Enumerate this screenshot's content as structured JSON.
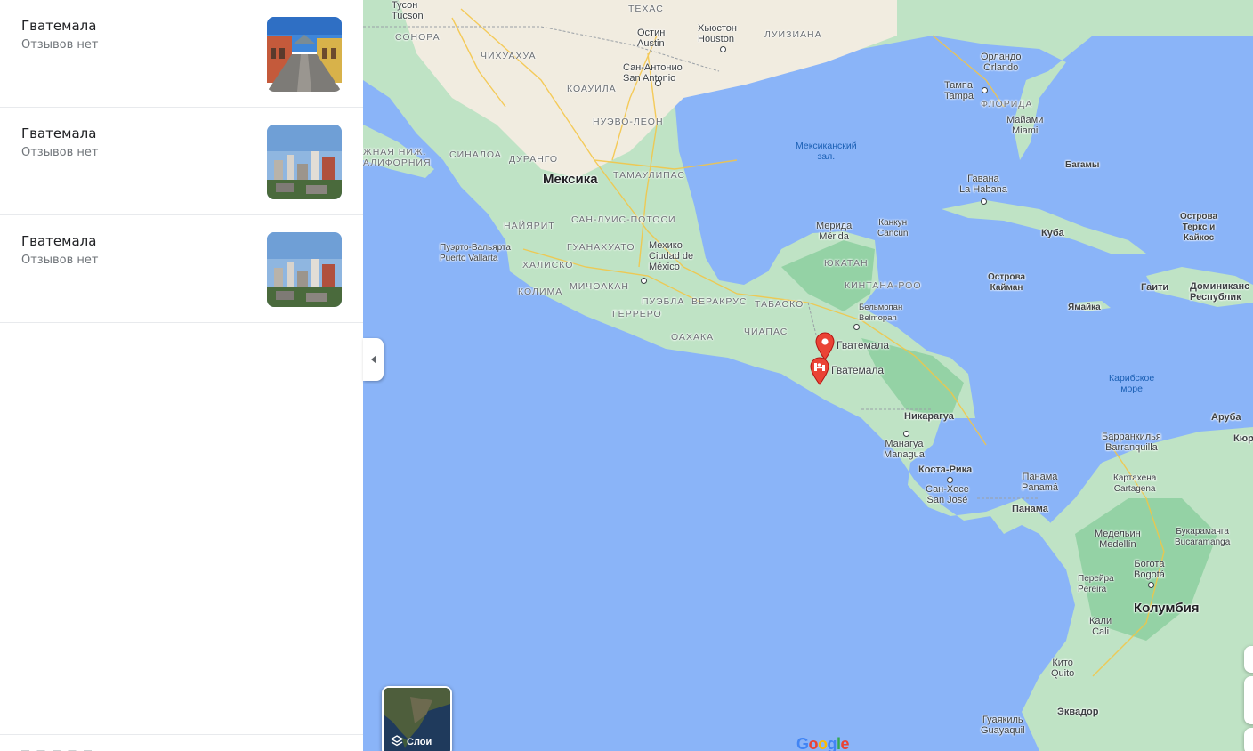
{
  "results": [
    {
      "title": "Гватемала",
      "reviews": "Отзывов нет",
      "photo": "street-photo"
    },
    {
      "title": "Гватемала",
      "reviews": "Отзывов нет",
      "photo": "city-photo"
    },
    {
      "title": "Гватемала",
      "reviews": "Отзывов нет",
      "photo": "city-photo"
    }
  ],
  "map": {
    "layers_label": "Слои",
    "logo": "Google",
    "colors": {
      "water": "#8ab4f8",
      "land": "#bfe3c5",
      "forest": "#94d2a5",
      "desert": "#f1ece0",
      "pin": "#ea4335"
    },
    "pins": [
      {
        "label": "Гватемала"
      },
      {
        "label": "Гватемала"
      }
    ],
    "labels": {
      "tucson": "Tucson",
      "tucson_ru": "Тусон",
      "texas": "ТЕХАС",
      "sonora": "СОНОРА",
      "austin_ru": "Остин",
      "austin": "Austin",
      "houston_ru": "Хьюстон",
      "houston": "Houston",
      "louisiana": "ЛУИЗИАНА",
      "chihuahua": "ЧИХУАХУА",
      "san_antonio_ru": "Сан-Антонио",
      "san_antonio": "San Antonio",
      "orlando_ru": "Орландо",
      "orlando": "Orlando",
      "tampa_ru": "Тампа",
      "tampa": "Tampa",
      "florida": "ФЛОРИДА",
      "miami_ru": "Майами",
      "miami": "Miami",
      "coahuila": "КОАУИЛА",
      "nuevo_leon": "НУЭВО-ЛЕОН",
      "gulf_1": "Мексиканский",
      "gulf_2": "зал.",
      "bahamas": "Багамы",
      "baja_1": "ЖНАЯ НИЖ.",
      "baja_2": "АЛИФОРНИЯ",
      "sinaloa": "СИНАЛОА",
      "durango": "ДУРАНГО",
      "mexico": "Мексика",
      "tamaulipas": "ТАМАУЛИПАС",
      "havana_ru": "Гавана",
      "havana": "La Habana",
      "slp": "САН-ЛУИС-ПОТОСИ",
      "nayarit": "НАЙЯРИТ",
      "merida_ru": "Мерида",
      "merida": "Mérida",
      "cancun_ru": "Канкун",
      "cancun": "Cancún",
      "cuba": "Куба",
      "turks_1": "Острова",
      "turks_2": "Теркс и",
      "turks_3": "Кайкос",
      "pv_ru": "Пуэрто-Вальярта",
      "pv": "Puerto Vallarta",
      "guanajuato": "ГУАНАХУАТО",
      "mexico_city_ru": "Мехико",
      "mexico_city_1": "Ciudad de",
      "mexico_city_2": "México",
      "yucatan": "ЮКАТАН",
      "jalisco": "ХАЛИСКО",
      "cayman_1": "Острова",
      "cayman_2": "Кайман",
      "haiti": "Гаити",
      "dominican_1": "Доминиканс",
      "dominican_2": "Республик",
      "colima": "КОЛИМА",
      "michoacan": "МИЧОАКАН",
      "puebla": "ПУЭБЛА",
      "veracruz": "ВЕРАКРУС",
      "qroo": "КИНТАНА-РОО",
      "tabasco": "ТАБАСКО",
      "belmopan_ru": "Бельмопан",
      "belmopan": "Belmopan",
      "jamaica": "Ямайка",
      "guerrero": "ГЕРРЕРО",
      "oaxaca": "ОАХАКА",
      "chiapas": "ЧИАПАС",
      "guatemala_1": "Гватемала",
      "guatemala_2": "Гватемала",
      "caribbean_1": "Карибское",
      "caribbean_2": "море",
      "nicaragua": "Никарагуа",
      "aruba": "Аруба",
      "curacao": "Кюр",
      "managua_ru": "Манагуа",
      "managua": "Managua",
      "barranquilla_ru": "Барранкилья",
      "barranquilla": "Barranquilla",
      "costa_rica": "Коста-Рика",
      "cartagena_ru": "Картахена",
      "cartagena": "Cartagena",
      "panama_city_ru": "Панама",
      "panama_city": "Panamá",
      "panama": "Панама",
      "san_jose_ru": "Сан-Хосе",
      "san_jose": "San José",
      "medellin_ru": "Медельин",
      "medellin": "Medellín",
      "bucaramanga_ru": "Букараманга",
      "bucaramanga": "Bucaramanga",
      "pereira_ru": "Перейра",
      "pereira": "Pereira",
      "bogota_ru": "Богота",
      "bogota": "Bogotá",
      "cali_ru": "Кали",
      "cali": "Cali",
      "colombia": "Колумбия",
      "quito_ru": "Кито",
      "quito": "Quito",
      "ecuador": "Эквадор",
      "guayaquil_ru": "Гуаякиль",
      "guayaquil": "Guayaquil"
    }
  }
}
